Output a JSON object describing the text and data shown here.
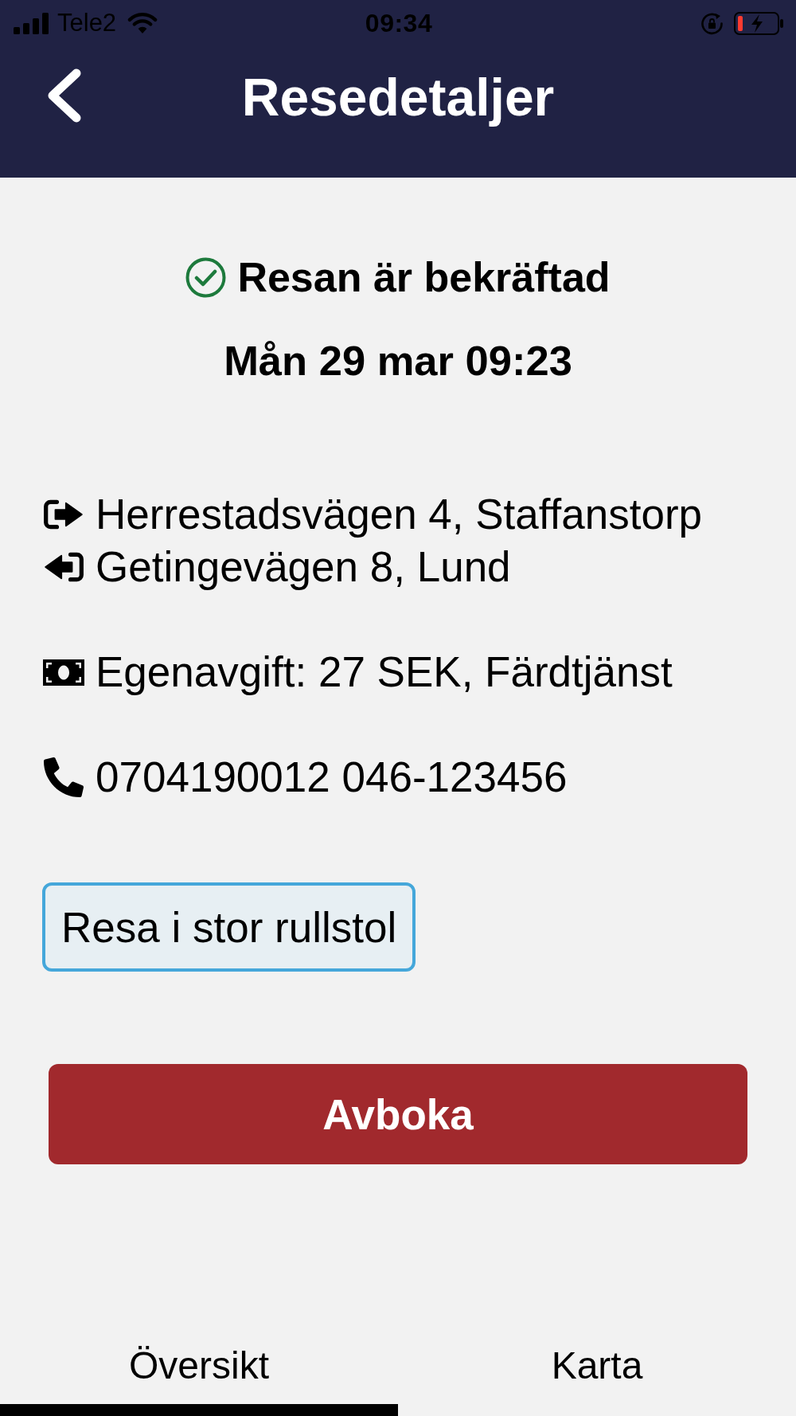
{
  "status_bar": {
    "carrier": "Tele2",
    "time": "09:34"
  },
  "header": {
    "title": "Resedetaljer"
  },
  "booking": {
    "confirmed": true,
    "status": "Resan är bekräftad",
    "datetime": "Mån 29 mar 09:23"
  },
  "details": [
    {
      "lines": [
        {
          "kind": "pickup",
          "text": "Herrestadsvägen 4, Staffanstorp"
        },
        {
          "kind": "dropoff",
          "text": "Getingevägen 8, Lund"
        }
      ]
    },
    {
      "lines": [
        {
          "kind": "fee",
          "text": "Egenavgift: 27 SEK, Färdtjänst"
        }
      ]
    },
    {
      "lines": [
        {
          "kind": "phone",
          "text": "0704190012 046-123456"
        }
      ]
    }
  ],
  "travel_needs": [
    "Resa i stor rullstol"
  ],
  "cancel_button": "Avboka",
  "tabs": [
    {
      "label": "Översikt",
      "selected": true
    },
    {
      "label": "Karta",
      "selected": false
    }
  ]
}
